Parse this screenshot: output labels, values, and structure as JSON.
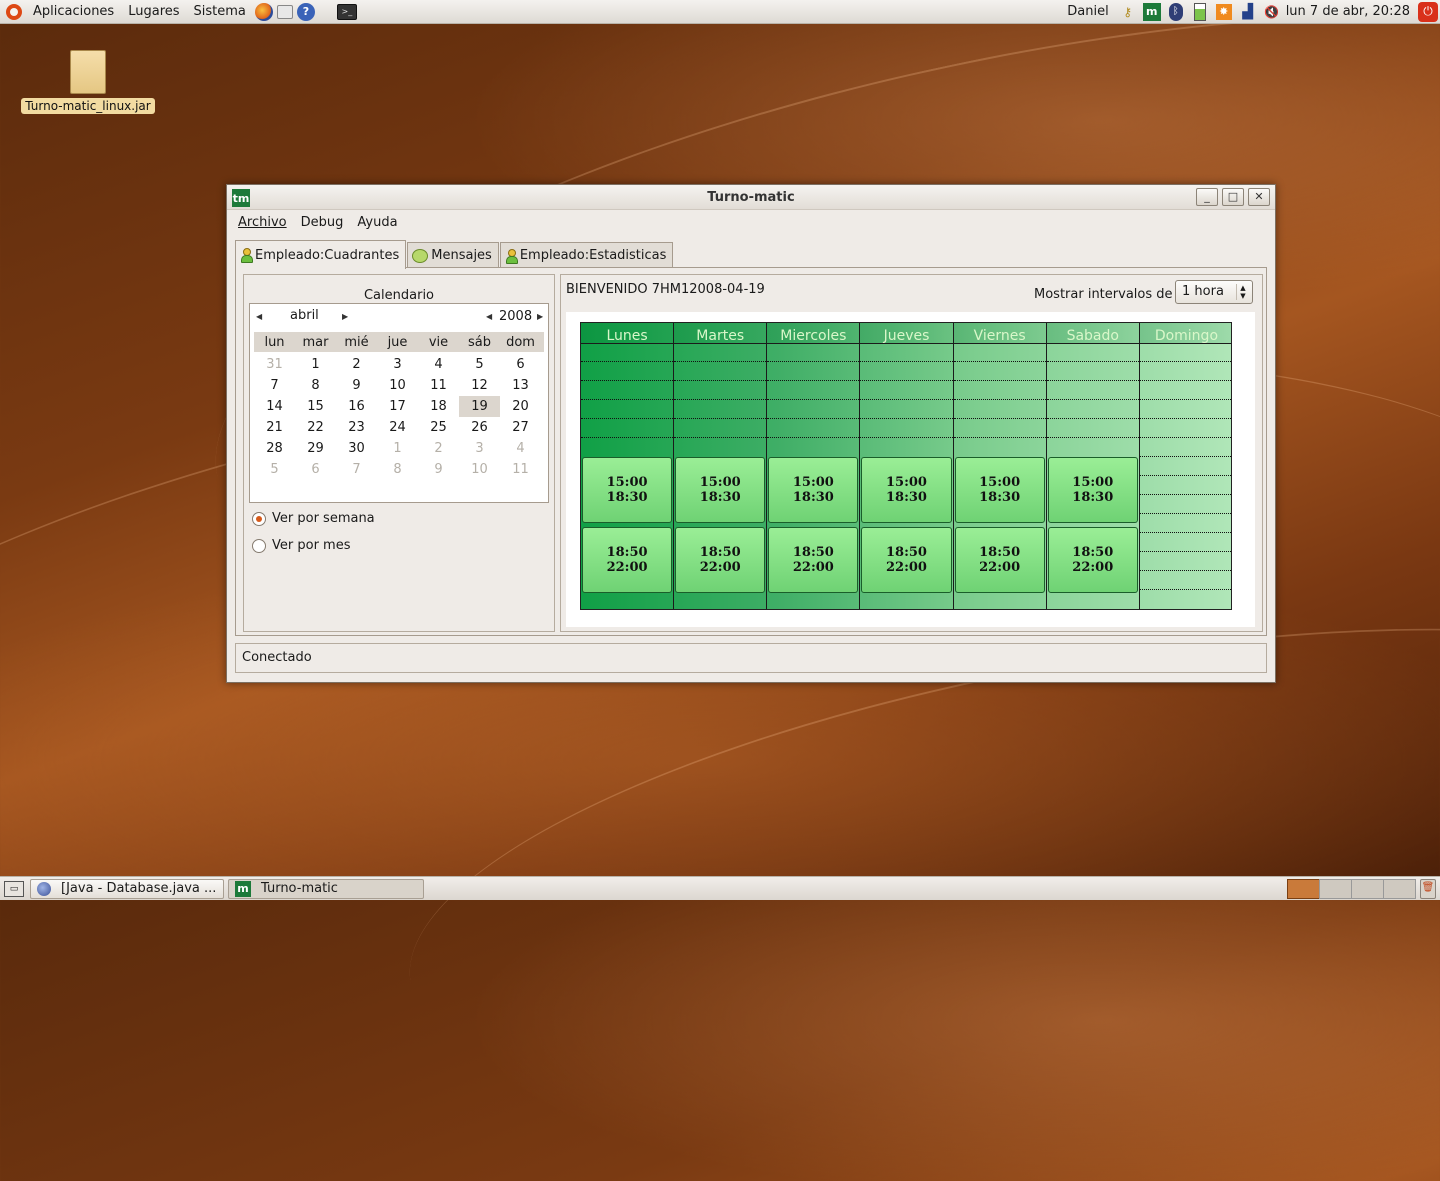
{
  "top_panel": {
    "menus": [
      "Aplicaciones",
      "Lugares",
      "Sistema"
    ],
    "launchers": [
      "firefox-icon",
      "mail-icon",
      "help-icon",
      "terminal-icon"
    ],
    "user": "Daniel",
    "tray_icons": [
      "keys-icon",
      "turno-matic-tray-icon",
      "bluetooth-icon",
      "battery-icon",
      "updates-icon",
      "signal-icon",
      "volume-icon"
    ],
    "clock": "lun  7 de abr, 20:28"
  },
  "desktop": {
    "icons": [
      {
        "label": "Turno-matic_linux.jar",
        "icon": "file-icon"
      }
    ]
  },
  "window": {
    "title": "Turno-matic",
    "app_icon_text": "tm",
    "menu": [
      "Archivo",
      "Debug",
      "Ayuda"
    ],
    "tabs": [
      {
        "label": "Empleado:Cuadrantes",
        "icon": "person-icon",
        "active": true
      },
      {
        "label": "Mensajes",
        "icon": "messages-icon",
        "active": false
      },
      {
        "label": "Empleado:Estadisticas",
        "icon": "person-icon",
        "active": false
      }
    ],
    "calendar": {
      "title": "Calendario",
      "month": "abril",
      "year": "2008",
      "weekdays": [
        "lun",
        "mar",
        "mié",
        "jue",
        "vie",
        "sáb",
        "dom"
      ],
      "selected_day": "19",
      "weeks": [
        [
          "31",
          "1",
          "2",
          "3",
          "4",
          "5",
          "6"
        ],
        [
          "7",
          "8",
          "9",
          "10",
          "11",
          "12",
          "13"
        ],
        [
          "14",
          "15",
          "16",
          "17",
          "18",
          "19",
          "20"
        ],
        [
          "21",
          "22",
          "23",
          "24",
          "25",
          "26",
          "27"
        ],
        [
          "28",
          "29",
          "30",
          "1",
          "2",
          "3",
          "4"
        ],
        [
          "5",
          "6",
          "7",
          "8",
          "9",
          "10",
          "11"
        ]
      ],
      "other_month": [
        [
          true,
          false,
          false,
          false,
          false,
          false,
          false
        ],
        [
          false,
          false,
          false,
          false,
          false,
          false,
          false
        ],
        [
          false,
          false,
          false,
          false,
          false,
          false,
          false
        ],
        [
          false,
          false,
          false,
          false,
          false,
          false,
          false
        ],
        [
          false,
          false,
          false,
          true,
          true,
          true,
          true
        ],
        [
          true,
          true,
          true,
          true,
          true,
          true,
          true
        ]
      ]
    },
    "view_options": [
      {
        "label": "Ver por semana",
        "checked": true
      },
      {
        "label": "Ver por mes",
        "checked": false
      }
    ],
    "schedule": {
      "welcome": "BIENVENIDO 7HM12008-04-19",
      "interval_label": "Mostrar intervalos de",
      "interval_value": "1 hora",
      "days": [
        "Lunes",
        "Martes",
        "Miercoles",
        "Jueves",
        "Viernes",
        "Sabado",
        "Domingo"
      ],
      "shifts": [
        {
          "start": "15:00",
          "end": "18:30"
        },
        {
          "start": "18:50",
          "end": "22:00"
        }
      ],
      "shift_days": 6
    },
    "status": "Conectado"
  },
  "taskbar": {
    "tasks": [
      {
        "label": "[Java - Database.java ...",
        "icon": "java-icon",
        "active": false
      },
      {
        "label": "Turno-matic",
        "icon": "turno-matic-icon",
        "active": true
      }
    ],
    "workspaces": 4,
    "active_workspace": 1
  },
  "colors": {
    "desktop": "#7a3a12",
    "schedule_green": "#10a046",
    "shift_green": "#8be88a",
    "accent_orange": "#d65a1a"
  }
}
